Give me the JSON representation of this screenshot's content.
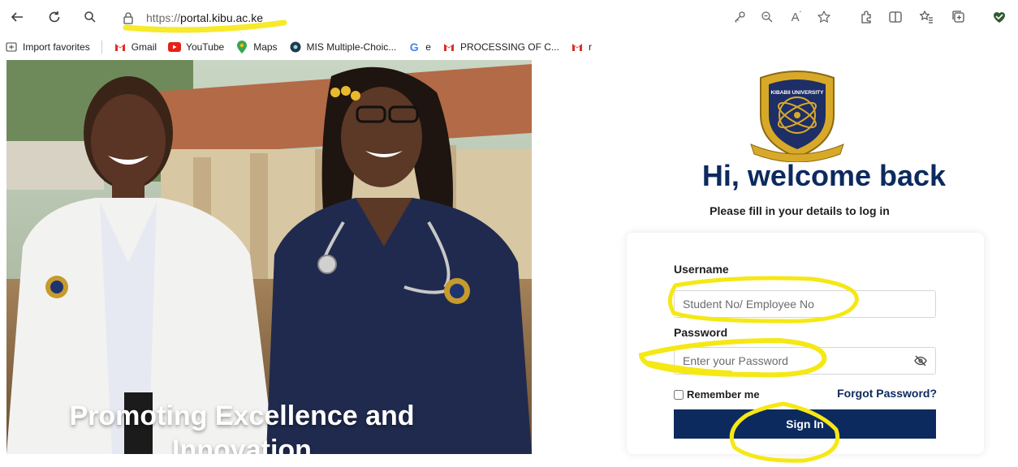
{
  "browser": {
    "url_protocol": "https://",
    "url_host": "portal.kibu.ac.ke",
    "favorites": [
      {
        "label": "Import favorites",
        "icon": "import-icon"
      },
      {
        "label": "Gmail",
        "icon": "gmail-icon"
      },
      {
        "label": "YouTube",
        "icon": "youtube-icon"
      },
      {
        "label": "Maps",
        "icon": "maps-pin-icon"
      },
      {
        "label": "MIS Multiple-Choic...",
        "icon": "site-icon"
      },
      {
        "label": "e",
        "icon": "google-icon"
      },
      {
        "label": "PROCESSING OF C...",
        "icon": "gmail-icon"
      },
      {
        "label": "r",
        "icon": "gmail-icon"
      }
    ]
  },
  "hero": {
    "caption_line1": "Promoting Excellence and",
    "caption_line2": "Innovation"
  },
  "login": {
    "logo_text": "KIBABII UNIVERSITY",
    "welcome": "Hi, welcome back",
    "subtitle": "Please fill in your details to log in",
    "username_label": "Username",
    "username_placeholder": "Student No/ Employee No",
    "password_label": "Password",
    "password_placeholder": "Enter your Password",
    "remember_label": "Remember me",
    "forgot_label": "Forgot Password?",
    "signin_label": "Sign In"
  },
  "colors": {
    "brand_navy": "#0c2a5e",
    "annotation_yellow": "#f5e814"
  }
}
